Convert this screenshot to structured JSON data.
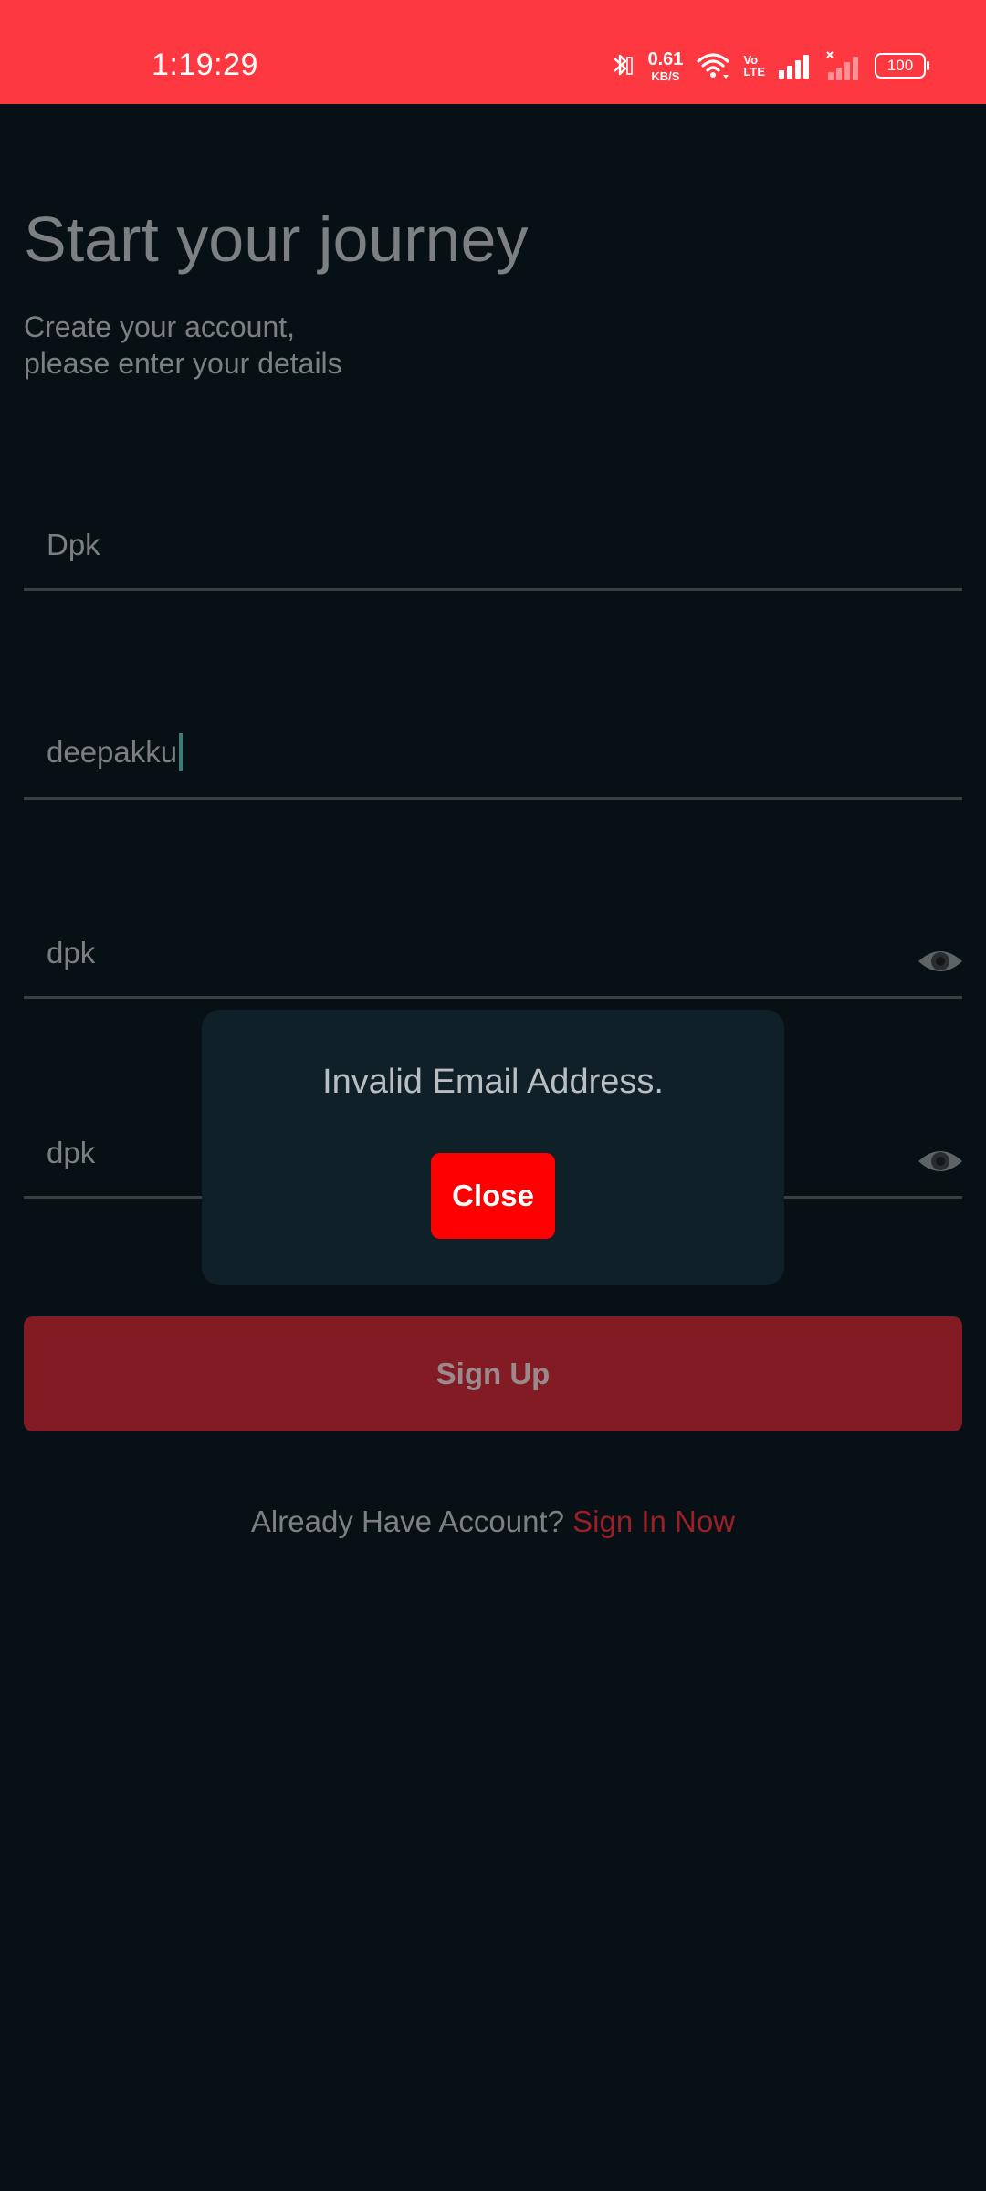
{
  "status_bar": {
    "time": "1:19:29",
    "net_speed_value": "0.61",
    "net_speed_unit": "KB/S",
    "volte_top": "Vo",
    "volte_bottom": "LTE",
    "battery": "100",
    "background_color": "#fe3841"
  },
  "header": {
    "title": "Start your journey",
    "subtitle_line1": "Create your account,",
    "subtitle_line2": "please enter your details"
  },
  "form": {
    "name_value": "Dpk",
    "email_value": "deepakku",
    "password_value": "dpk",
    "confirm_password_value": "dpk",
    "signup_label": "Sign Up",
    "signup_color": "#821b24"
  },
  "footer": {
    "prompt": "Already Have Account?",
    "link": "Sign In Now"
  },
  "dialog": {
    "message": "Invalid Email Address.",
    "close_label": "Close",
    "close_color": "#fe0000"
  },
  "icons": {
    "bluetooth": "bluetooth-icon",
    "wifi": "wifi-icon",
    "signal": "signal-icon",
    "eye": "eye-icon"
  }
}
